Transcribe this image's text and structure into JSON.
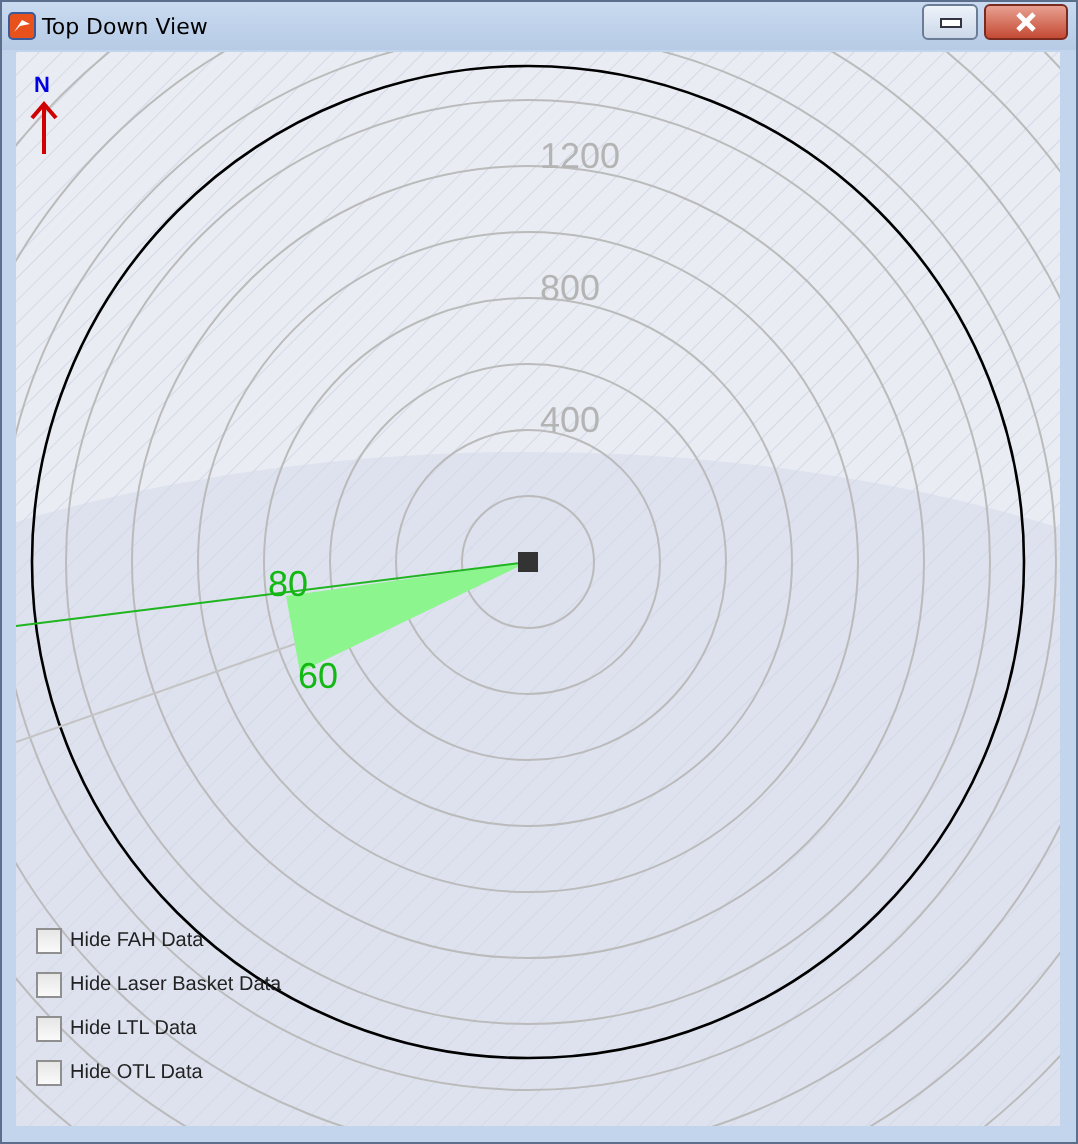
{
  "window": {
    "title": "Top Down View"
  },
  "compass": {
    "label": "N"
  },
  "range_labels": [
    "1200",
    "800",
    "400"
  ],
  "sector": {
    "labels": [
      "80",
      "60"
    ]
  },
  "options": [
    {
      "label": "Hide FAH Data",
      "checked": false
    },
    {
      "label": "Hide Laser Basket Data",
      "checked": false
    },
    {
      "label": "Hide LTL Data",
      "checked": false
    },
    {
      "label": "Hide OTL Data",
      "checked": false
    }
  ]
}
